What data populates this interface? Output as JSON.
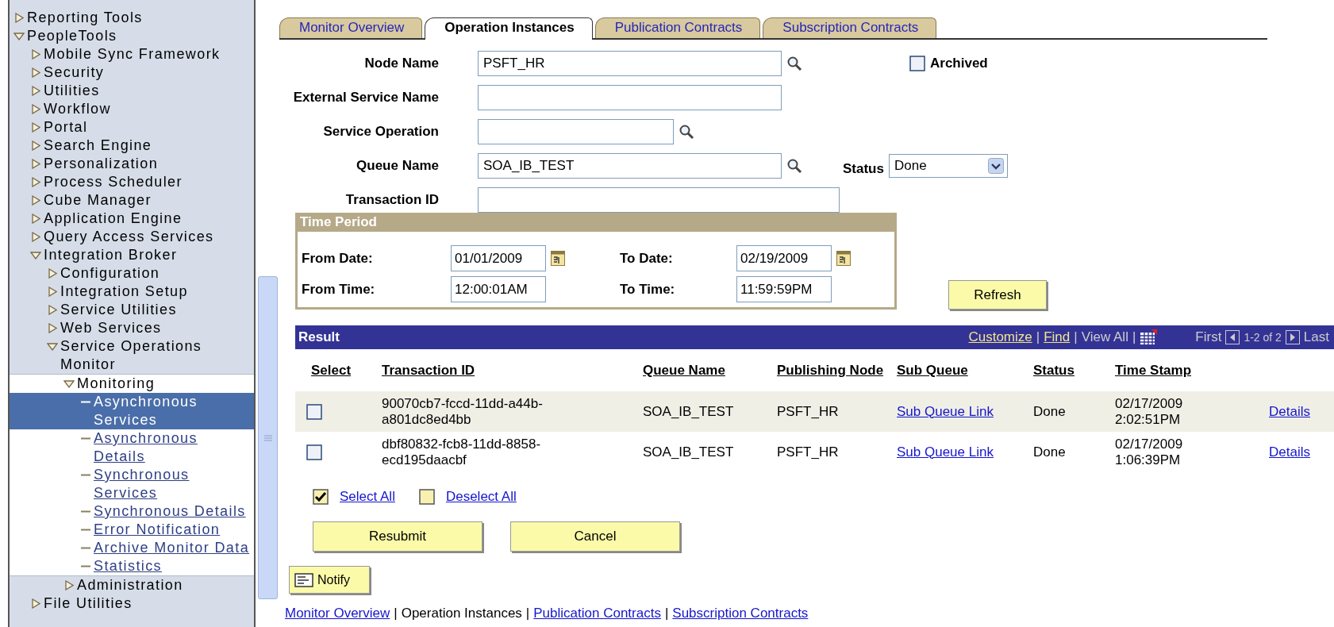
{
  "sidebar": {
    "items": [
      {
        "label": "Reporting Tools",
        "kind": "folder",
        "expanded": false,
        "selected": false
      },
      {
        "label": "PeopleTools",
        "kind": "folder",
        "expanded": true,
        "selected": false,
        "children": [
          {
            "label": "Mobile Sync Framework",
            "kind": "folder",
            "expanded": false,
            "selected": false
          },
          {
            "label": "Security",
            "kind": "folder",
            "expanded": false,
            "selected": false
          },
          {
            "label": "Utilities",
            "kind": "folder",
            "expanded": false,
            "selected": false
          },
          {
            "label": "Workflow",
            "kind": "folder",
            "expanded": false,
            "selected": false
          },
          {
            "label": "Portal",
            "kind": "folder",
            "expanded": false,
            "selected": false
          },
          {
            "label": "Search Engine",
            "kind": "folder",
            "expanded": false,
            "selected": false
          },
          {
            "label": "Personalization",
            "kind": "folder",
            "expanded": false,
            "selected": false
          },
          {
            "label": "Process Scheduler",
            "kind": "folder",
            "expanded": false,
            "selected": false
          },
          {
            "label": "Cube Manager",
            "kind": "folder",
            "expanded": false,
            "selected": false
          },
          {
            "label": "Application Engine",
            "kind": "folder",
            "expanded": false,
            "selected": false
          },
          {
            "label": "Query Access Services",
            "kind": "folder",
            "expanded": false,
            "selected": false
          },
          {
            "label": "Integration Broker",
            "kind": "folder",
            "expanded": true,
            "selected": false,
            "children": [
              {
                "label": "Configuration",
                "kind": "folder",
                "expanded": false,
                "selected": false
              },
              {
                "label": "Integration Setup",
                "kind": "folder",
                "expanded": false,
                "selected": false
              },
              {
                "label": "Service Utilities",
                "kind": "folder",
                "expanded": false,
                "selected": false
              },
              {
                "label": "Web Services",
                "kind": "folder",
                "expanded": false,
                "selected": false
              },
              {
                "label": "Service Operations Monitor",
                "kind": "folder",
                "expanded": true,
                "selected": false,
                "children": [
                  {
                    "label": "Monitoring",
                    "kind": "folder",
                    "expanded": true,
                    "selected": false,
                    "children": [
                      {
                        "label": "Asynchronous Services",
                        "kind": "link",
                        "selected": true
                      },
                      {
                        "label": "Asynchronous Details",
                        "kind": "link",
                        "selected": false
                      },
                      {
                        "label": "Synchronous Services",
                        "kind": "link",
                        "selected": false
                      },
                      {
                        "label": "Synchronous Details",
                        "kind": "link",
                        "selected": false
                      },
                      {
                        "label": "Error Notification",
                        "kind": "link",
                        "selected": false
                      },
                      {
                        "label": "Archive Monitor Data",
                        "kind": "link",
                        "selected": false
                      },
                      {
                        "label": "Statistics",
                        "kind": "link",
                        "selected": false
                      }
                    ]
                  },
                  {
                    "label": "Administration",
                    "kind": "folder",
                    "expanded": false,
                    "selected": false
                  }
                ]
              }
            ]
          },
          {
            "label": "File Utilities",
            "kind": "folder",
            "expanded": false,
            "selected": false
          }
        ]
      }
    ]
  },
  "tabs": [
    {
      "label": "Monitor Overview",
      "selected": false
    },
    {
      "label": "Operation Instances",
      "selected": true
    },
    {
      "label": "Publication Contracts",
      "selected": false
    },
    {
      "label": "Subscription Contracts",
      "selected": false
    }
  ],
  "form": {
    "fields": [
      {
        "label": "Node Name",
        "value": "PSFT_HR",
        "lookup": true
      },
      {
        "label": "External Service Name",
        "lookup": false
      },
      {
        "label": "Service Operation",
        "lookup": true
      },
      {
        "label": "Queue Name",
        "value": "SOA_IB_TEST",
        "lookup": true
      },
      {
        "label": "Transaction ID",
        "lookup": false
      }
    ],
    "archived": {
      "label": "Archived",
      "checked": false
    },
    "status": {
      "label": "Status",
      "value": "Done"
    }
  },
  "time_period": {
    "title": "Time Period",
    "fields": [
      {
        "label": "From Date:",
        "value": "01/01/2009",
        "calendar": true
      },
      {
        "label": "To Date:",
        "value": "02/19/2009",
        "calendar": true
      },
      {
        "label": "From Time:",
        "value": "12:00:01AM",
        "calendar": false
      },
      {
        "label": "To Time:",
        "value": "11:59:59PM",
        "calendar": false
      }
    ]
  },
  "refresh_button": "Refresh",
  "result": {
    "title": "Result",
    "toolbar": [
      {
        "kind": "link",
        "text": "Customize"
      },
      {
        "kind": "separator",
        "text": "|"
      },
      {
        "kind": "link",
        "text": "Find"
      },
      {
        "kind": "separator",
        "text": "|"
      },
      {
        "kind": "text",
        "text": "View All"
      },
      {
        "kind": "separator",
        "text": "|"
      },
      {
        "kind": "grid"
      }
    ],
    "nav": {
      "first": "First",
      "range": "1-2 of 2",
      "last": "Last"
    },
    "columns": [
      "Select",
      "Transaction ID",
      "Queue Name",
      "Publishing Node",
      "Sub Queue",
      "Status",
      "Time Stamp"
    ],
    "rows": [
      {
        "checked": false,
        "transaction_id": "90070cb7-fccd-11dd-a44b-a801dc8ed4bb",
        "queue_name": "SOA_IB_TEST",
        "publishing_node": "PSFT_HR",
        "sub_queue": "Sub Queue Link",
        "status": "Done",
        "time_stamp": "02/17/2009 2:02:51PM",
        "details": "Details"
      },
      {
        "checked": false,
        "transaction_id": "dbf80832-fcb8-11dd-8858-ecd195daacbf",
        "queue_name": "SOA_IB_TEST",
        "publishing_node": "PSFT_HR",
        "sub_queue": "Sub Queue Link",
        "status": "Done",
        "time_stamp": "02/17/2009 1:06:39PM",
        "details": "Details"
      }
    ],
    "select_all": {
      "label": "Select All",
      "checked": true
    },
    "deselect_all": {
      "label": "Deselect All",
      "checked": false
    }
  },
  "buttons": [
    "Resubmit",
    "Cancel"
  ],
  "notify_button": "Notify",
  "footer_links": [
    {
      "kind": "link",
      "text": "Monitor Overview"
    },
    {
      "kind": "separator",
      "text": "|"
    },
    {
      "kind": "text",
      "text": "Operation Instances"
    },
    {
      "kind": "separator",
      "text": "|"
    },
    {
      "kind": "link",
      "text": "Publication Contracts"
    },
    {
      "kind": "separator",
      "text": "|"
    },
    {
      "kind": "link",
      "text": "Subscription Contracts"
    }
  ]
}
